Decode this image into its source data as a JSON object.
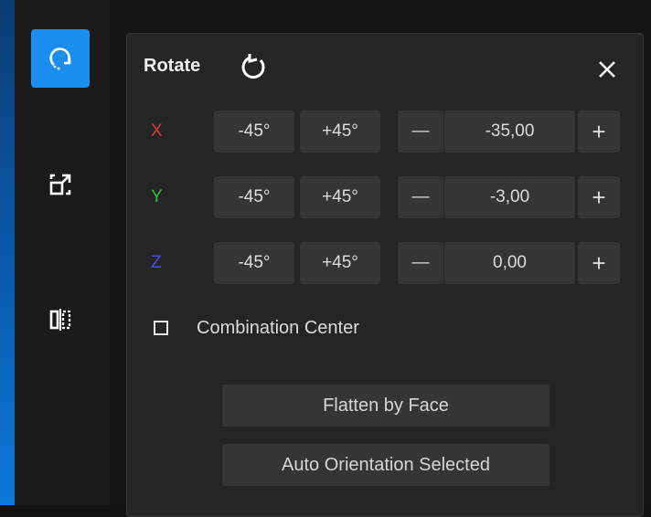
{
  "sidebar": {
    "tools": [
      {
        "icon": "rotate-tool-icon",
        "active": true
      },
      {
        "icon": "scale-tool-icon",
        "active": false
      },
      {
        "icon": "mirror-tool-icon",
        "active": false
      }
    ]
  },
  "panel": {
    "title": "Rotate",
    "reset_icon": "rotate-reset-icon",
    "close_icon": "close-icon",
    "axes": [
      {
        "label": "X",
        "color": "#d63a3a",
        "minus45": "-45°",
        "plus45": "+45°",
        "decrement": "—",
        "value": "-35,00",
        "increment": "+"
      },
      {
        "label": "Y",
        "color": "#2fbf3f",
        "minus45": "-45°",
        "plus45": "+45°",
        "decrement": "—",
        "value": "-3,00",
        "increment": "+"
      },
      {
        "label": "Z",
        "color": "#4650e0",
        "minus45": "-45°",
        "plus45": "+45°",
        "decrement": "—",
        "value": "0,00",
        "increment": "+"
      }
    ],
    "combination_center": {
      "label": "Combination Center",
      "checked": false
    },
    "flatten_by_face": "Flatten by Face",
    "auto_orientation": "Auto Orientation Selected"
  },
  "colors": {
    "accent": "#1b8ef0",
    "panel_bg": "#252525",
    "button_bg": "#353535"
  }
}
